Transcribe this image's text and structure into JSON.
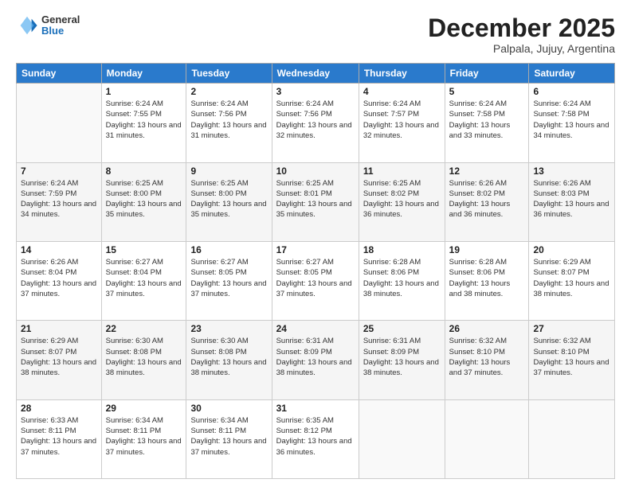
{
  "header": {
    "logo": {
      "general": "General",
      "blue": "Blue"
    },
    "title": "December 2025",
    "subtitle": "Palpala, Jujuy, Argentina"
  },
  "columns": [
    "Sunday",
    "Monday",
    "Tuesday",
    "Wednesday",
    "Thursday",
    "Friday",
    "Saturday"
  ],
  "weeks": [
    [
      {
        "day": "",
        "info": ""
      },
      {
        "day": "1",
        "info": "Sunrise: 6:24 AM\nSunset: 7:55 PM\nDaylight: 13 hours and 31 minutes."
      },
      {
        "day": "2",
        "info": "Sunrise: 6:24 AM\nSunset: 7:56 PM\nDaylight: 13 hours and 31 minutes."
      },
      {
        "day": "3",
        "info": "Sunrise: 6:24 AM\nSunset: 7:56 PM\nDaylight: 13 hours and 32 minutes."
      },
      {
        "day": "4",
        "info": "Sunrise: 6:24 AM\nSunset: 7:57 PM\nDaylight: 13 hours and 32 minutes."
      },
      {
        "day": "5",
        "info": "Sunrise: 6:24 AM\nSunset: 7:58 PM\nDaylight: 13 hours and 33 minutes."
      },
      {
        "day": "6",
        "info": "Sunrise: 6:24 AM\nSunset: 7:58 PM\nDaylight: 13 hours and 34 minutes."
      }
    ],
    [
      {
        "day": "7",
        "info": "Sunrise: 6:24 AM\nSunset: 7:59 PM\nDaylight: 13 hours and 34 minutes."
      },
      {
        "day": "8",
        "info": "Sunrise: 6:25 AM\nSunset: 8:00 PM\nDaylight: 13 hours and 35 minutes."
      },
      {
        "day": "9",
        "info": "Sunrise: 6:25 AM\nSunset: 8:00 PM\nDaylight: 13 hours and 35 minutes."
      },
      {
        "day": "10",
        "info": "Sunrise: 6:25 AM\nSunset: 8:01 PM\nDaylight: 13 hours and 35 minutes."
      },
      {
        "day": "11",
        "info": "Sunrise: 6:25 AM\nSunset: 8:02 PM\nDaylight: 13 hours and 36 minutes."
      },
      {
        "day": "12",
        "info": "Sunrise: 6:26 AM\nSunset: 8:02 PM\nDaylight: 13 hours and 36 minutes."
      },
      {
        "day": "13",
        "info": "Sunrise: 6:26 AM\nSunset: 8:03 PM\nDaylight: 13 hours and 36 minutes."
      }
    ],
    [
      {
        "day": "14",
        "info": "Sunrise: 6:26 AM\nSunset: 8:04 PM\nDaylight: 13 hours and 37 minutes."
      },
      {
        "day": "15",
        "info": "Sunrise: 6:27 AM\nSunset: 8:04 PM\nDaylight: 13 hours and 37 minutes."
      },
      {
        "day": "16",
        "info": "Sunrise: 6:27 AM\nSunset: 8:05 PM\nDaylight: 13 hours and 37 minutes."
      },
      {
        "day": "17",
        "info": "Sunrise: 6:27 AM\nSunset: 8:05 PM\nDaylight: 13 hours and 37 minutes."
      },
      {
        "day": "18",
        "info": "Sunrise: 6:28 AM\nSunset: 8:06 PM\nDaylight: 13 hours and 38 minutes."
      },
      {
        "day": "19",
        "info": "Sunrise: 6:28 AM\nSunset: 8:06 PM\nDaylight: 13 hours and 38 minutes."
      },
      {
        "day": "20",
        "info": "Sunrise: 6:29 AM\nSunset: 8:07 PM\nDaylight: 13 hours and 38 minutes."
      }
    ],
    [
      {
        "day": "21",
        "info": "Sunrise: 6:29 AM\nSunset: 8:07 PM\nDaylight: 13 hours and 38 minutes."
      },
      {
        "day": "22",
        "info": "Sunrise: 6:30 AM\nSunset: 8:08 PM\nDaylight: 13 hours and 38 minutes."
      },
      {
        "day": "23",
        "info": "Sunrise: 6:30 AM\nSunset: 8:08 PM\nDaylight: 13 hours and 38 minutes."
      },
      {
        "day": "24",
        "info": "Sunrise: 6:31 AM\nSunset: 8:09 PM\nDaylight: 13 hours and 38 minutes."
      },
      {
        "day": "25",
        "info": "Sunrise: 6:31 AM\nSunset: 8:09 PM\nDaylight: 13 hours and 38 minutes."
      },
      {
        "day": "26",
        "info": "Sunrise: 6:32 AM\nSunset: 8:10 PM\nDaylight: 13 hours and 37 minutes."
      },
      {
        "day": "27",
        "info": "Sunrise: 6:32 AM\nSunset: 8:10 PM\nDaylight: 13 hours and 37 minutes."
      }
    ],
    [
      {
        "day": "28",
        "info": "Sunrise: 6:33 AM\nSunset: 8:11 PM\nDaylight: 13 hours and 37 minutes."
      },
      {
        "day": "29",
        "info": "Sunrise: 6:34 AM\nSunset: 8:11 PM\nDaylight: 13 hours and 37 minutes."
      },
      {
        "day": "30",
        "info": "Sunrise: 6:34 AM\nSunset: 8:11 PM\nDaylight: 13 hours and 37 minutes."
      },
      {
        "day": "31",
        "info": "Sunrise: 6:35 AM\nSunset: 8:12 PM\nDaylight: 13 hours and 36 minutes."
      },
      {
        "day": "",
        "info": ""
      },
      {
        "day": "",
        "info": ""
      },
      {
        "day": "",
        "info": ""
      }
    ]
  ]
}
